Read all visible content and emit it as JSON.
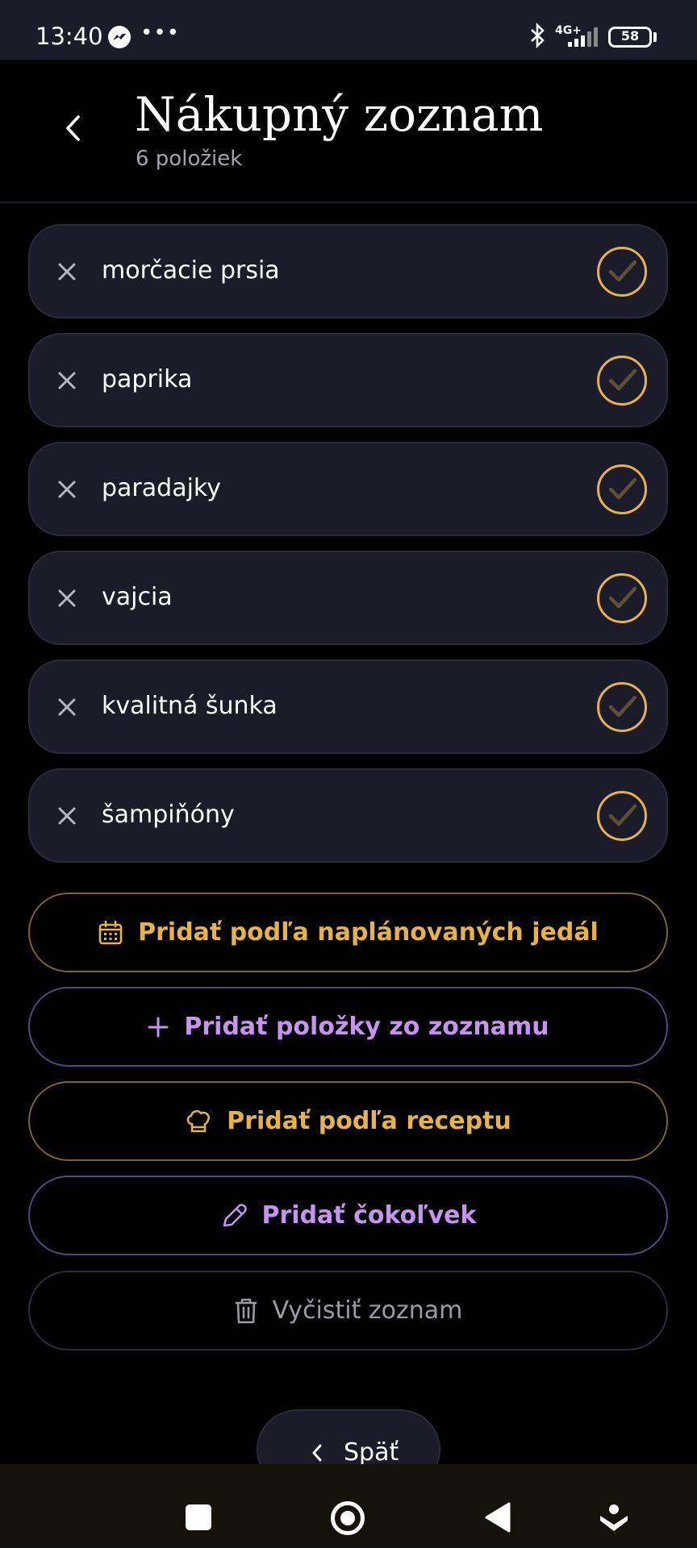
{
  "status_bar": {
    "time": "13:40",
    "network": "4G+",
    "battery": "58",
    "icons": [
      "messenger-icon",
      "more-dots-icon",
      "bluetooth-icon",
      "signal-icon",
      "battery-icon"
    ]
  },
  "header": {
    "title": "Nákupný zoznam",
    "subtitle": "6 položiek",
    "back_icon": "chevron-left-icon"
  },
  "items": [
    {
      "label": "morčacie prsia"
    },
    {
      "label": "paprika"
    },
    {
      "label": "paradajky"
    },
    {
      "label": "vajcia"
    },
    {
      "label": "kvalitná šunka"
    },
    {
      "label": "šampiňóny"
    }
  ],
  "actions": {
    "planned_meals": {
      "label": "Pridať podľa naplánovaných jedál",
      "icon": "calendar-icon"
    },
    "from_list": {
      "label": "Pridať položky zo zoznamu",
      "icon": "plus-icon"
    },
    "from_recipe": {
      "label": "Pridať podľa receptu",
      "icon": "chef-hat-icon"
    },
    "anything": {
      "label": "Pridať čokoľvek",
      "icon": "pencil-icon"
    },
    "clear": {
      "label": "Vyčistiť zoznam",
      "icon": "trash-icon"
    }
  },
  "back_button": {
    "label": "Späť"
  },
  "colors": {
    "accent_gold": "#e7b246",
    "accent_purple": "#c593f0",
    "card_bg": "#1b1b2a",
    "page_bg": "#000000"
  }
}
